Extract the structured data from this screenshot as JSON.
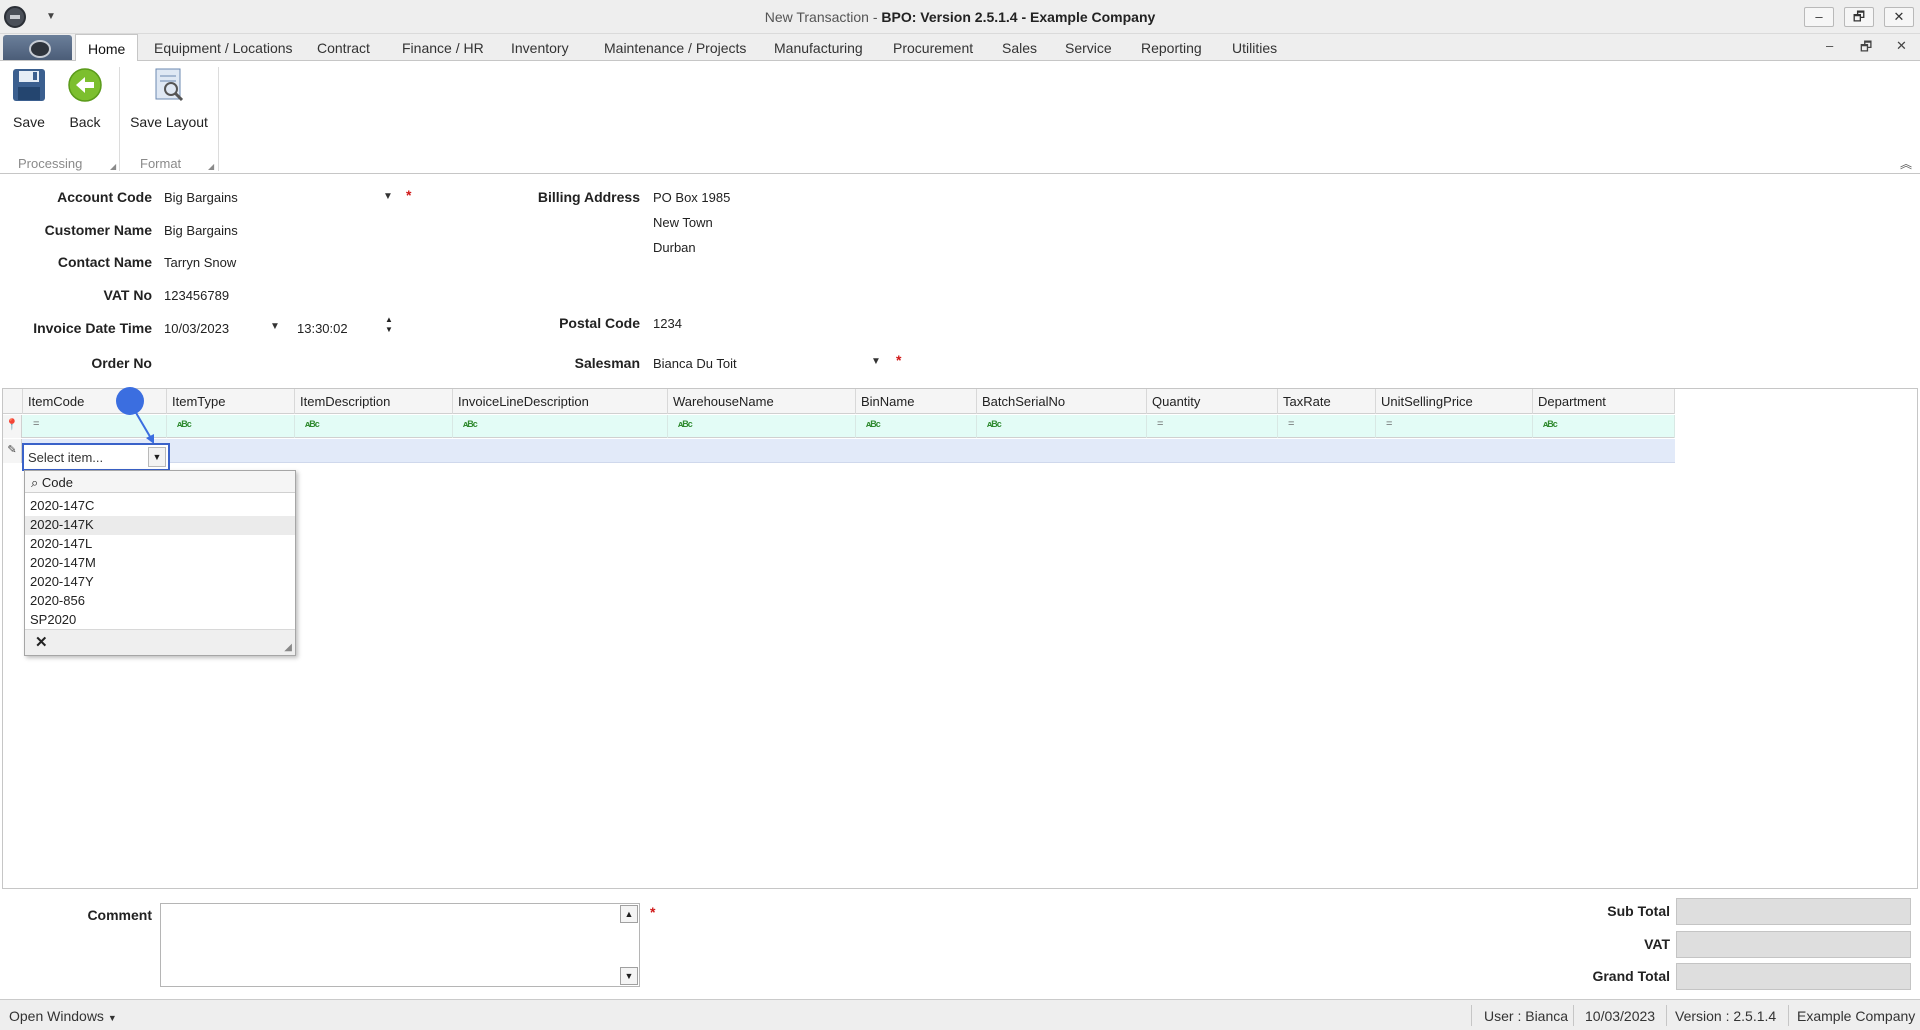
{
  "window": {
    "title_prefix": "New Transaction - ",
    "title_bold": "BPO: Version 2.5.1.4 - Example Company",
    "minimize": "–",
    "restore": "🗗",
    "close": "✕"
  },
  "menu": {
    "tabs": [
      "Home",
      "Equipment / Locations",
      "Contract",
      "Finance / HR",
      "Inventory",
      "Maintenance / Projects",
      "Manufacturing",
      "Procurement",
      "Sales",
      "Service",
      "Reporting",
      "Utilities"
    ],
    "active": "Home"
  },
  "ribbon": {
    "save": "Save",
    "back": "Back",
    "save_layout": "Save Layout",
    "group_processing": "Processing",
    "group_format": "Format"
  },
  "form": {
    "account_code_label": "Account Code",
    "account_code": "Big Bargains",
    "customer_name_label": "Customer Name",
    "customer_name": "Big Bargains",
    "contact_name_label": "Contact Name",
    "contact_name": "Tarryn Snow",
    "vat_no_label": "VAT No",
    "vat_no": "123456789",
    "invoice_dt_label": "Invoice Date Time",
    "invoice_date": "10/03/2023",
    "invoice_time": "13:30:02",
    "order_no_label": "Order No",
    "billing_address_label": "Billing Address",
    "billing_line1": "PO Box 1985",
    "billing_line2": "New Town",
    "billing_line3": "Durban",
    "postal_code_label": "Postal Code",
    "postal_code": "1234",
    "salesman_label": "Salesman",
    "salesman": "Bianca Du Toit",
    "required_mark": "*"
  },
  "grid": {
    "columns": [
      "ItemCode",
      "ItemType",
      "ItemDescription",
      "InvoiceLineDescription",
      "WarehouseName",
      "BinName",
      "BatchSerialNo",
      "Quantity",
      "TaxRate",
      "UnitSellingPrice",
      "Department"
    ],
    "filter_eq": "=",
    "filter_abc": "ᴀBc"
  },
  "combo": {
    "placeholder": "Select item...",
    "header": "Code",
    "items": [
      "2020-147C",
      "2020-147K",
      "2020-147L",
      "2020-147M",
      "2020-147Y",
      "2020-856",
      "SP2020"
    ],
    "highlighted": "2020-147K"
  },
  "bottom": {
    "comment_label": "Comment",
    "sub_total_label": "Sub Total",
    "vat_label": "VAT",
    "grand_total_label": "Grand Total"
  },
  "status": {
    "open_windows": "Open Windows",
    "user": "User : Bianca",
    "date": "10/03/2023",
    "version": "Version : 2.5.1.4",
    "company": "Example Company"
  },
  "colors": {
    "accent": "#3a62c9",
    "filter_row": "#e3fcf6",
    "new_row": "#e2eaf9",
    "required": "#d01818"
  }
}
